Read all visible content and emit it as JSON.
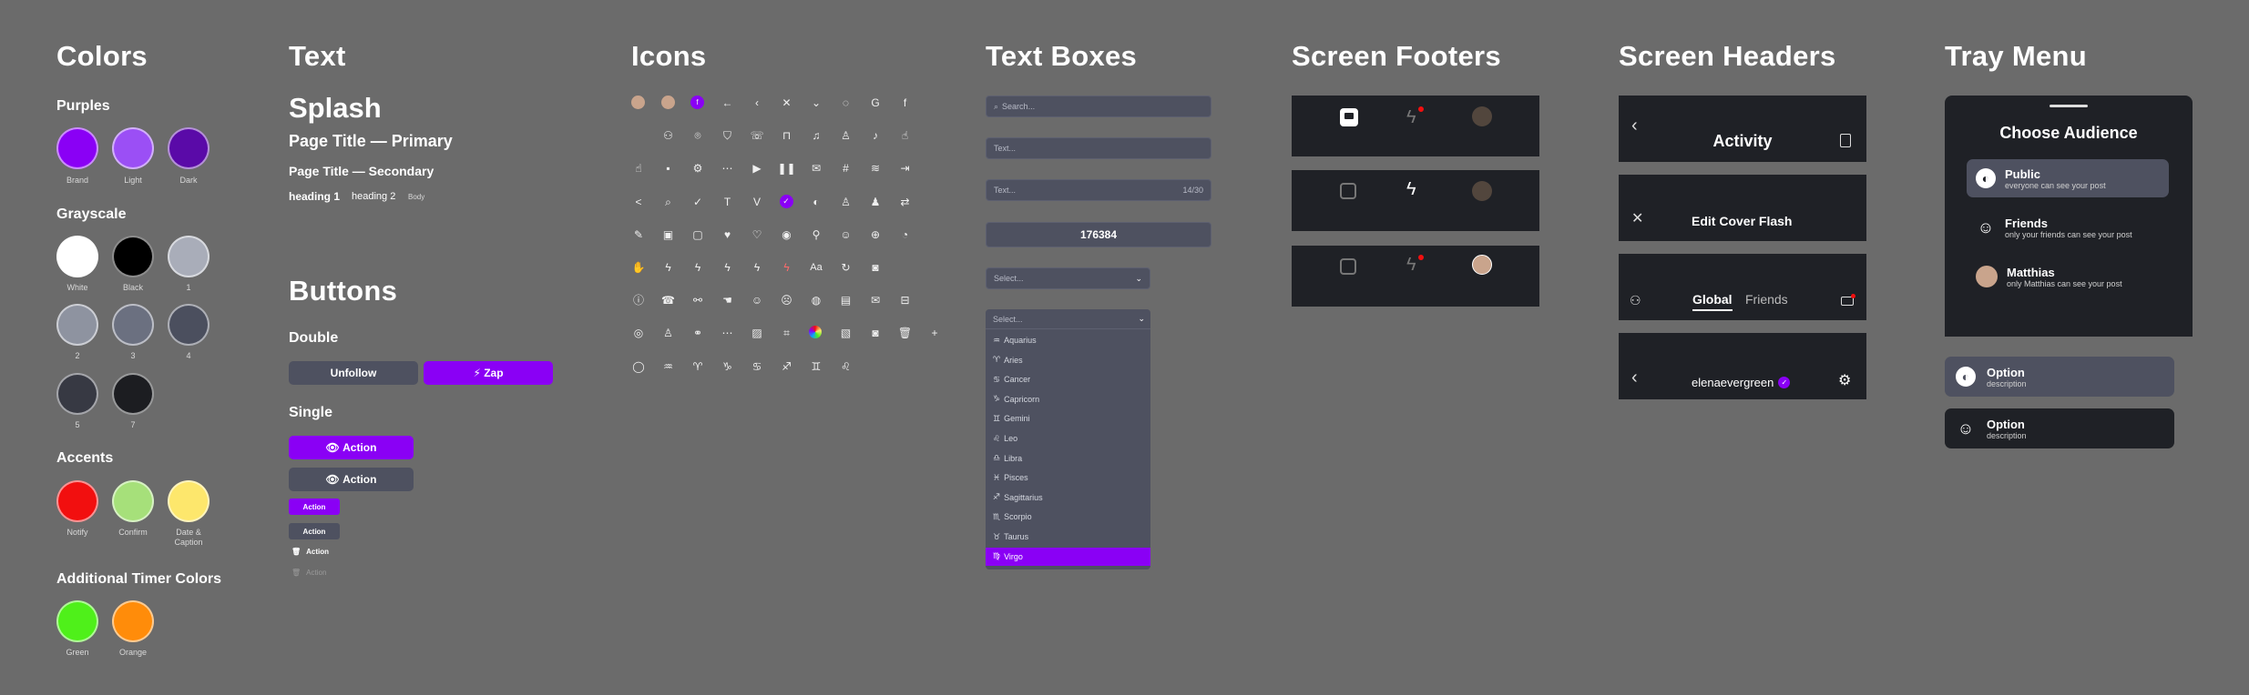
{
  "colors": {
    "title": "Colors",
    "purples": {
      "heading": "Purples",
      "swatches": [
        {
          "label": "Brand",
          "hex": "#8a00f5"
        },
        {
          "label": "Light",
          "hex": "#9b4ff5"
        },
        {
          "label": "Dark",
          "hex": "#5a0aa8"
        }
      ]
    },
    "grayscale": {
      "heading": "Grayscale",
      "swatches": [
        {
          "label": "White",
          "hex": "#ffffff"
        },
        {
          "label": "Black",
          "hex": "#000000"
        },
        {
          "label": "1",
          "hex": "#a9adb9"
        },
        {
          "label": "2",
          "hex": "#8e93a0"
        },
        {
          "label": "3",
          "hex": "#6b7080"
        },
        {
          "label": "4",
          "hex": "#4b4f5e"
        },
        {
          "label": "5",
          "hex": "#373943"
        },
        {
          "label": "7",
          "hex": "#1c1d21"
        }
      ]
    },
    "accents": {
      "heading": "Accents",
      "swatches": [
        {
          "label": "Notify",
          "hex": "#f20f0f"
        },
        {
          "label": "Confirm",
          "hex": "#a6e07a"
        },
        {
          "label": "Date &\nCaption",
          "hex": "#fde76c"
        }
      ]
    },
    "timers": {
      "heading": "Additional Timer Colors",
      "swatches": [
        {
          "label": "Green",
          "hex": "#4ff01a"
        },
        {
          "label": "Orange",
          "hex": "#ff8c0a"
        }
      ]
    }
  },
  "text": {
    "title": "Text",
    "splash": "Splash",
    "page_title_primary": "Page Title — Primary",
    "page_title_secondary": "Page Title — Secondary",
    "heading1": "heading 1",
    "heading2": "heading 2",
    "body": "Body"
  },
  "buttons": {
    "title": "Buttons",
    "double_heading": "Double",
    "unfollow": "Unfollow",
    "zap": "Zap",
    "single_heading": "Single",
    "action": "Action"
  },
  "icons": {
    "title": "Icons"
  },
  "text_boxes": {
    "title": "Text Boxes",
    "search_placeholder": "Search...",
    "text_placeholder": "Text...",
    "text_placeholder2": "Text...",
    "counter": "14/30",
    "number_value": "176384",
    "select_placeholder": "Select...",
    "select_placeholder2": "Select...",
    "options": [
      "Aquarius",
      "Aries",
      "Cancer",
      "Capricorn",
      "Gemini",
      "Leo",
      "Libra",
      "Pisces",
      "Sagittarius",
      "Scorpio",
      "Taurus",
      "Virgo"
    ],
    "selected": "Virgo"
  },
  "footers": {
    "title": "Screen Footers"
  },
  "headers": {
    "title": "Screen Headers",
    "activity": "Activity",
    "edit_cover": "Edit Cover Flash",
    "tab_global": "Global",
    "tab_friends": "Friends",
    "username": "elenaevergreen"
  },
  "tray": {
    "title": "Tray Menu",
    "heading": "Choose Audience",
    "items": [
      {
        "title": "Public",
        "desc": "everyone can see your post"
      },
      {
        "title": "Friends",
        "desc": "only your friends can see your post"
      },
      {
        "title": "Matthias",
        "desc": "only Matthias can see your post"
      }
    ],
    "option1": {
      "title": "Option",
      "desc": "description"
    },
    "option2": {
      "title": "Option",
      "desc": "description"
    }
  }
}
